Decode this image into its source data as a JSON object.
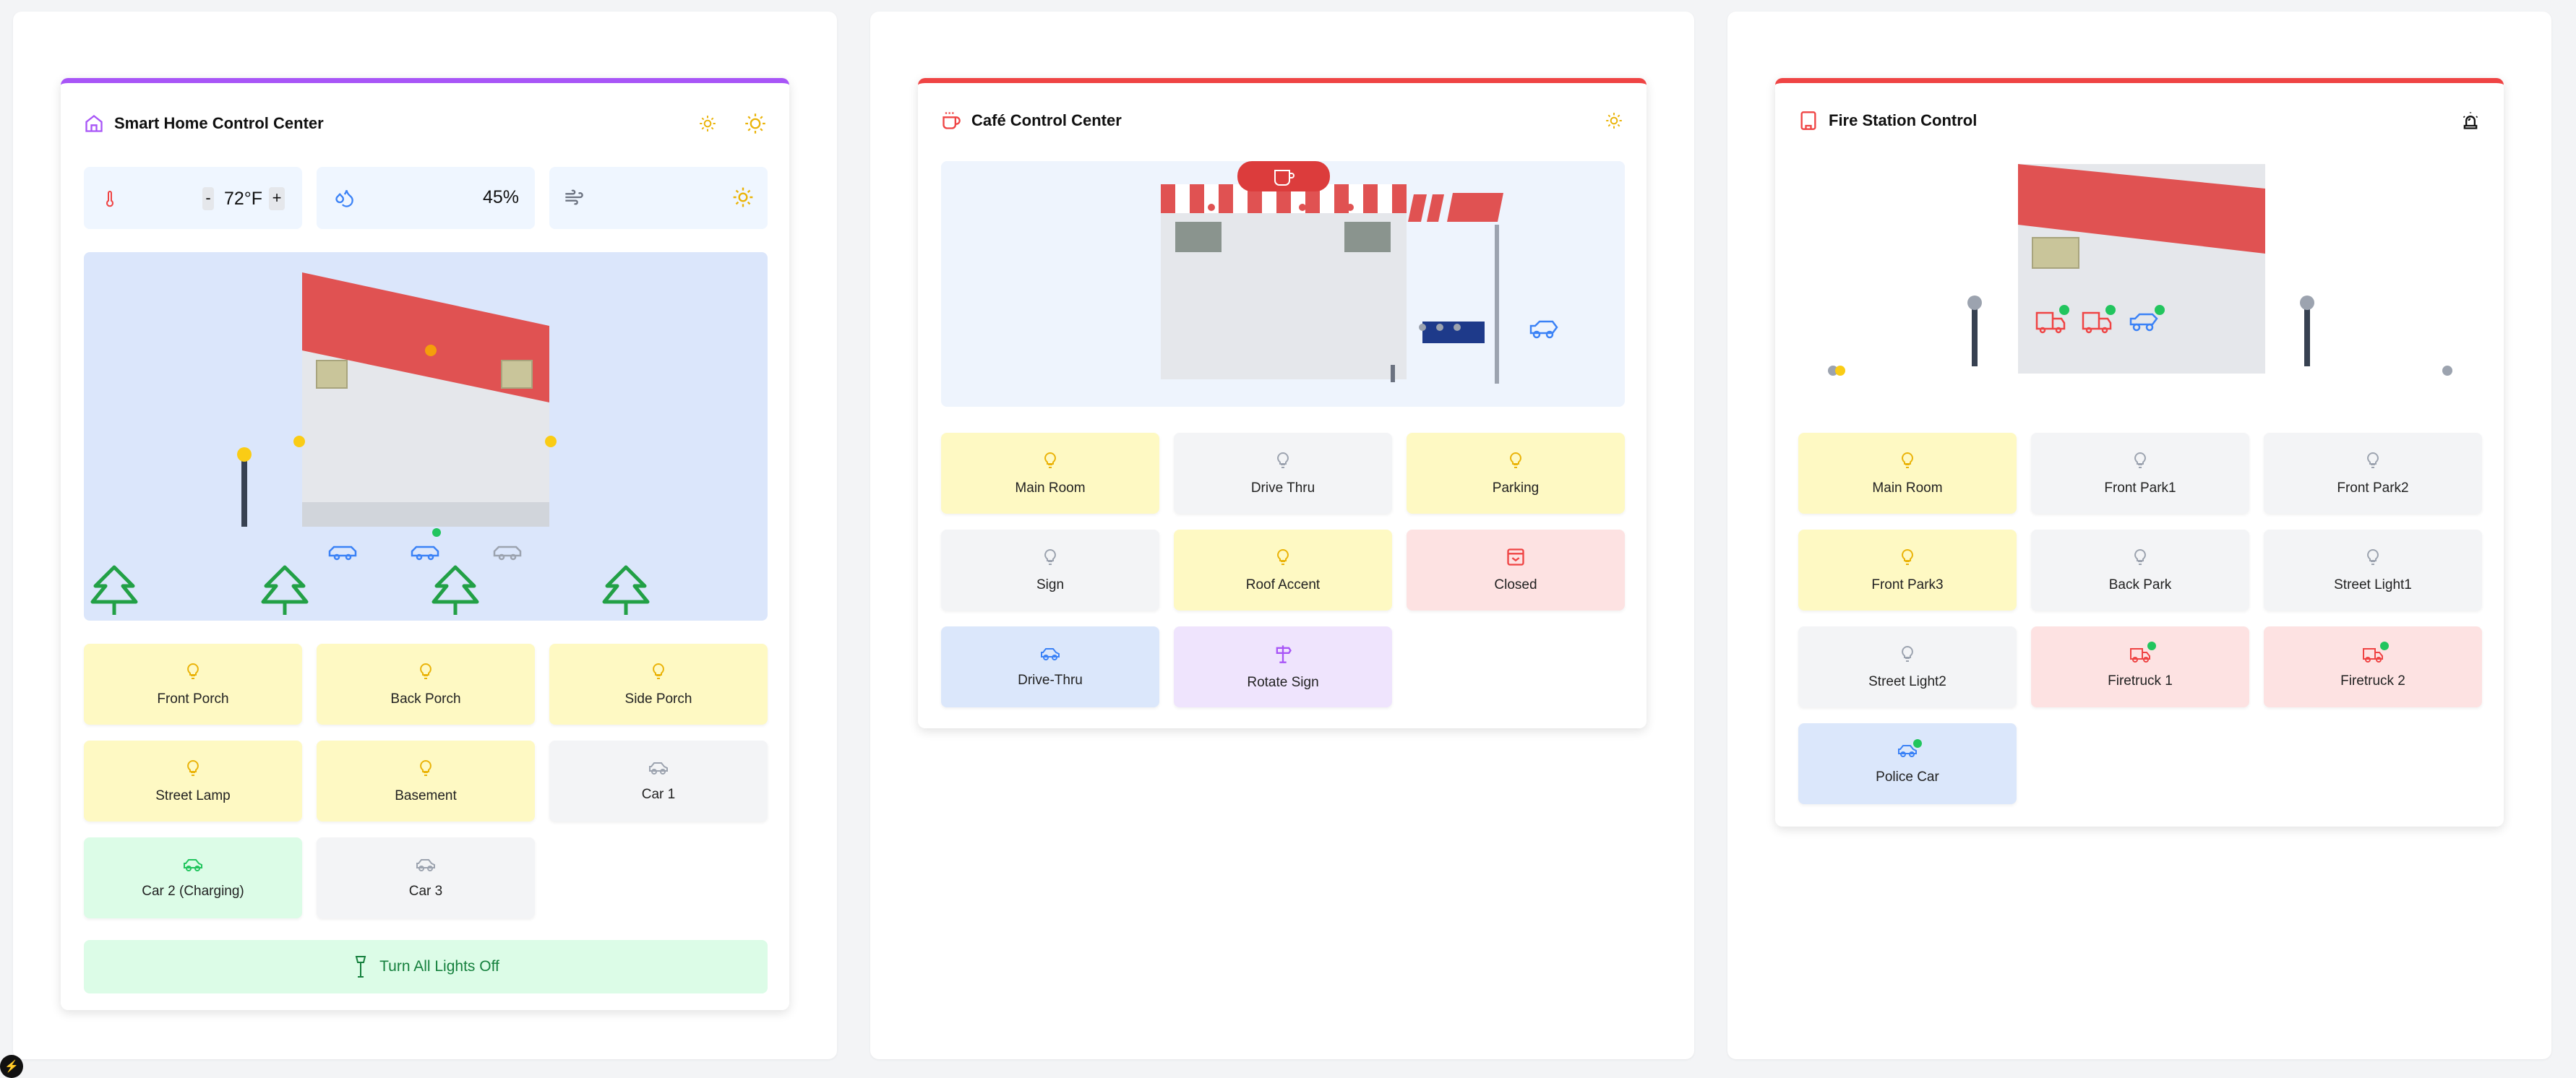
{
  "smart_home": {
    "title": "Smart Home Control Center",
    "temperature": "72°F",
    "temp_minus": "-",
    "temp_plus": "+",
    "humidity": "45%",
    "tiles": [
      "Front Porch",
      "Back Porch",
      "Side Porch",
      "Street Lamp",
      "Basement",
      "Car 1",
      "Car 2 (Charging)",
      "Car 3"
    ],
    "all_off": "Turn All Lights Off"
  },
  "cafe": {
    "title": "Café Control Center",
    "tiles": [
      "Main Room",
      "Drive Thru",
      "Parking",
      "Sign",
      "Roof Accent",
      "Closed",
      "Drive-Thru",
      "Rotate Sign"
    ]
  },
  "fire_station": {
    "title": "Fire Station Control",
    "tiles": [
      "Main Room",
      "Front Park1",
      "Front Park2",
      "Front Park3",
      "Back Park",
      "Street Light1",
      "Street Light2",
      "Firetruck 1",
      "Firetruck 2",
      "Police Car"
    ]
  },
  "colors": {
    "accent_purple": "#a855f7",
    "accent_red": "#ef4444",
    "light_on": "#eab308",
    "status_green": "#22c55e",
    "vehicle_blue": "#3b82f6"
  }
}
